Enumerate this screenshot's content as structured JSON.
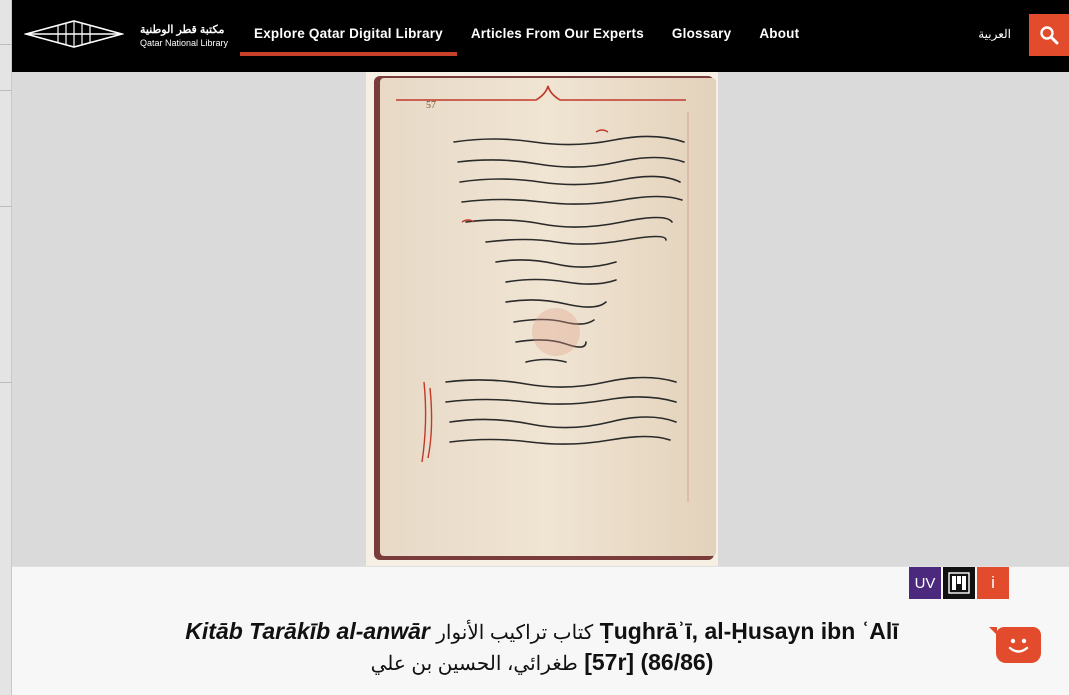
{
  "brand": {
    "name_ar": "مكتبة قطر الوطنية",
    "name_en": "Qatar National Library",
    "accent_color": "#e24b2b",
    "uv_color": "#4b2a7d"
  },
  "nav": {
    "items": [
      {
        "label": "Explore Qatar Digital Library",
        "active": true
      },
      {
        "label": "Articles From Our Experts",
        "active": false
      },
      {
        "label": "Glossary",
        "active": false
      },
      {
        "label": "About",
        "active": false
      }
    ],
    "language_toggle": "العربية",
    "search_icon": "search-icon"
  },
  "viewer": {
    "page_image": "manuscript-page"
  },
  "bottom": {
    "badges": {
      "uv": "UV",
      "mirador_icon": "mirador-icon",
      "info": "i"
    },
    "title": {
      "part_italic": "Kitāb Tarākīb al-anwār",
      "part_ar": "كتاب تراكيب الأنوار",
      "part_author": "Ṭughrāʾī, al-Ḥusayn ibn ʿAlī",
      "part_author_ar": "طغرائي، الحسين بن علي",
      "part_folio": "[57r] (86/86)"
    },
    "chat_icon": "chat-icon"
  }
}
